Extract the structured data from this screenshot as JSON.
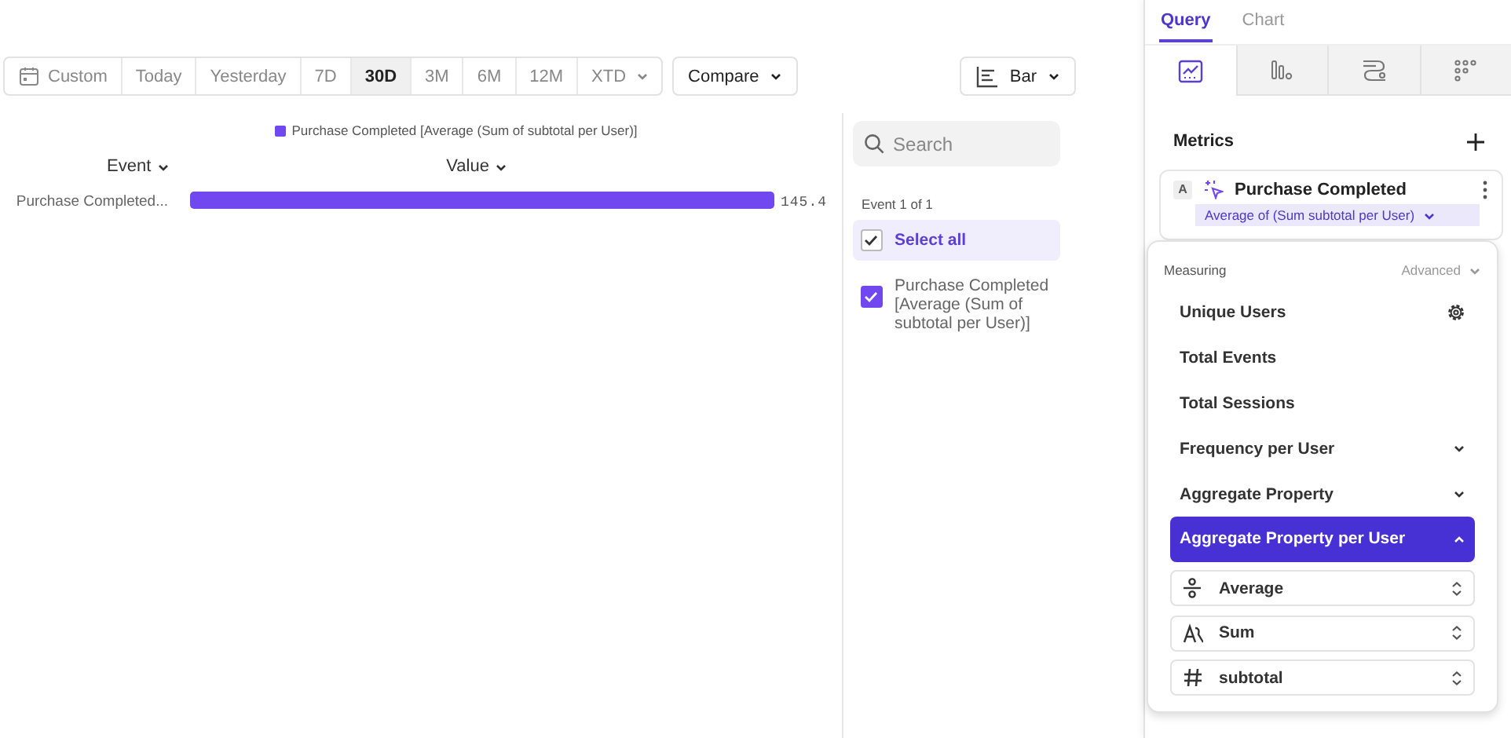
{
  "date_range": {
    "options": [
      {
        "label": "Custom",
        "kind": "custom",
        "selected": false
      },
      {
        "label": "Today",
        "kind": "preset",
        "selected": false
      },
      {
        "label": "Yesterday",
        "kind": "preset",
        "selected": false
      },
      {
        "label": "7D",
        "kind": "preset",
        "selected": false
      },
      {
        "label": "30D",
        "kind": "preset",
        "selected": true
      },
      {
        "label": "3M",
        "kind": "preset",
        "selected": false
      },
      {
        "label": "6M",
        "kind": "preset",
        "selected": false
      },
      {
        "label": "12M",
        "kind": "preset",
        "selected": false
      },
      {
        "label": "XTD",
        "kind": "dropdown",
        "selected": false
      }
    ]
  },
  "compare_button": {
    "label": "Compare"
  },
  "chart_type_button": {
    "label": "Bar"
  },
  "chart": {
    "columns": [
      {
        "label": "Event"
      },
      {
        "label": "Value"
      }
    ],
    "chart_data": {
      "type": "bar",
      "orientation": "horizontal",
      "categories": [
        "Purchase Completed..."
      ],
      "series": [
        {
          "name": "Purchase Completed [Average (Sum of subtotal per User)]",
          "color": "#7148f0",
          "values": [
            145.4
          ]
        }
      ],
      "data_labels": true
    }
  },
  "event_filter": {
    "search": {
      "placeholder": "Search"
    },
    "count": "Event 1 of 1",
    "items": [
      {
        "label": "Select all",
        "kind": "select-all",
        "checked": true
      },
      {
        "label": "Purchase Completed [Average (Sum of subtotal per User)]",
        "kind": "event",
        "checked": true
      }
    ]
  },
  "sidebar": {
    "tabs": [
      {
        "label": "Query",
        "selected": true
      },
      {
        "label": "Chart",
        "selected": false
      }
    ],
    "view_tabs": [
      {
        "kind": "line",
        "selected": true
      },
      {
        "kind": "bars",
        "selected": false
      },
      {
        "kind": "flows",
        "selected": false
      },
      {
        "kind": "dots",
        "selected": false
      }
    ],
    "metrics": {
      "title": "Metrics",
      "items": [
        {
          "letter": "A",
          "name": "Purchase Completed",
          "measure": "Average of (Sum subtotal per User)"
        }
      ]
    }
  },
  "measuring_menu": {
    "title": "Measuring",
    "mode": "Advanced",
    "options": [
      {
        "label": "Unique Users",
        "kind": "settings",
        "selected": false
      },
      {
        "label": "Total Events",
        "kind": "plain",
        "selected": false
      },
      {
        "label": "Total Sessions",
        "kind": "plain",
        "selected": false
      },
      {
        "label": "Frequency per User",
        "kind": "expandable",
        "expanded": false,
        "selected": false
      },
      {
        "label": "Aggregate Property",
        "kind": "expandable",
        "expanded": false,
        "selected": false
      },
      {
        "label": "Aggregate Property per User",
        "kind": "expandable",
        "expanded": true,
        "selected": true,
        "selects": [
          {
            "kind": "function",
            "value": "Average"
          },
          {
            "kind": "aggregation",
            "value": "Sum"
          },
          {
            "kind": "number",
            "value": "subtotal"
          }
        ]
      }
    ]
  }
}
